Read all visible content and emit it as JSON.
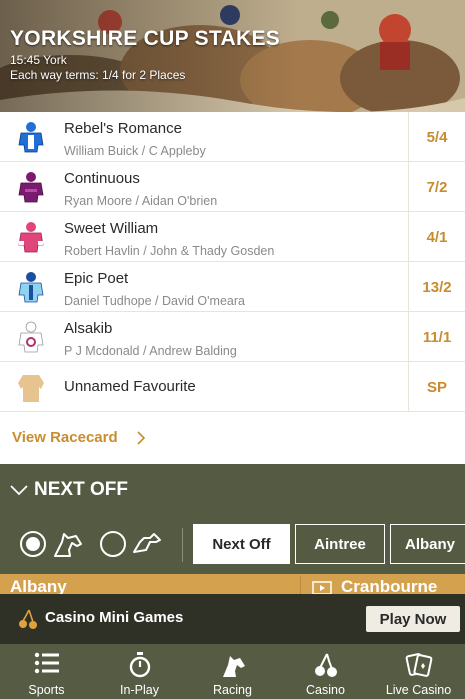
{
  "race": {
    "title": "YORKSHIRE CUP STAKES",
    "time_venue": "15:45 York",
    "each_way": "Each way terms: 1/4 for 2 Places"
  },
  "runners": [
    {
      "name": "Rebel's Romance",
      "connections": "William Buick / C Appleby",
      "odds": "5/4",
      "silk_colors": [
        "#1f6fd6",
        "#ffffff"
      ]
    },
    {
      "name": "Continuous",
      "connections": "Ryan Moore / Aidan O'brien",
      "odds": "7/2",
      "silk_colors": [
        "#7b1b6f",
        "#b94aa6"
      ]
    },
    {
      "name": "Sweet William",
      "connections": "Robert Havlin / John & Thady Gosden",
      "odds": "4/1",
      "silk_colors": [
        "#e0457b",
        "#ffffff"
      ]
    },
    {
      "name": "Epic Poet",
      "connections": "Daniel Tudhope / David O'meara",
      "odds": "13/2",
      "silk_colors": [
        "#8fd3f0",
        "#1a4fa0"
      ]
    },
    {
      "name": "Alsakib",
      "connections": "P J Mcdonald / Andrew Balding",
      "odds": "11/1",
      "silk_colors": [
        "#ffffff",
        "#b3306a"
      ]
    },
    {
      "name": "Unnamed Favourite",
      "connections": "",
      "odds": "SP",
      "silk_colors": [
        "#e6c38f",
        "#e6c38f"
      ]
    }
  ],
  "view_racecard": "View Racecard",
  "next_off": {
    "title": "NEXT OFF",
    "tabs": [
      "Next Off",
      "Aintree",
      "Albany"
    ],
    "active_tab": "Next Off",
    "race_left": "Albany",
    "race_right": "Cranbourne"
  },
  "casino": {
    "label": "Casino Mini Games",
    "cta": "Play Now"
  },
  "nav": [
    {
      "label": "Sports",
      "icon": "menu-icon"
    },
    {
      "label": "In-Play",
      "icon": "stopwatch-icon"
    },
    {
      "label": "Racing",
      "icon": "horse-head-icon"
    },
    {
      "label": "Casino",
      "icon": "cherries-icon"
    },
    {
      "label": "Live Casino",
      "icon": "playing-cards-icon"
    }
  ],
  "colors": {
    "accent": "#c98c2e",
    "olive": "#555b42",
    "dark": "#2f3127",
    "strip": "#d4a24e"
  }
}
